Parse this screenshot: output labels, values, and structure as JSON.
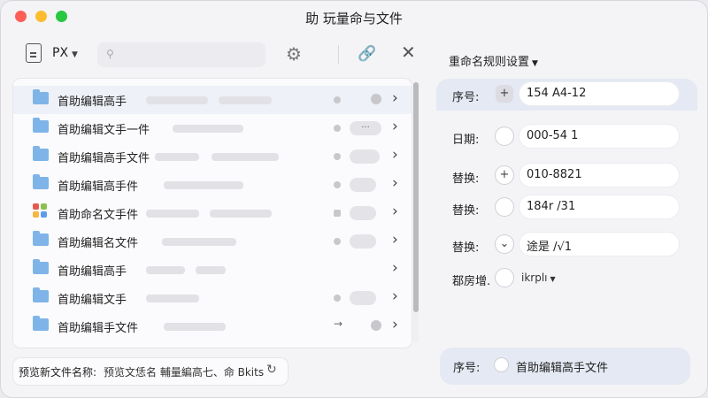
{
  "window": {
    "title": "助 玩量命与文件"
  },
  "toolbar": {
    "format_label": "PX",
    "icons": [
      "file-icon",
      "search-icon",
      "gear-icon",
      "link-icon",
      "close-icon"
    ]
  },
  "file_list": {
    "rows": [
      {
        "name": "首助编辑高手",
        "icon": "folder-icon",
        "badge": ""
      },
      {
        "name": "首助编辑文手一件",
        "icon": "folder-icon",
        "badge": "···"
      },
      {
        "name": "首助编辑高手文件",
        "icon": "folder-icon",
        "badge": ""
      },
      {
        "name": "首助编辑高手件",
        "icon": "folder-icon",
        "badge": ""
      },
      {
        "name": "首助命名文手件",
        "icon": "app-icon",
        "badge": ""
      },
      {
        "name": "首助编辑名文件",
        "icon": "folder-icon",
        "badge": ""
      },
      {
        "name": "首助编辑高手",
        "icon": "folder-icon",
        "badge": ""
      },
      {
        "name": "首助编辑文手",
        "icon": "folder-icon",
        "badge": ""
      },
      {
        "name": "首助编辑手文件",
        "icon": "folder-icon",
        "badge": ""
      }
    ]
  },
  "preview": {
    "label": "预览新文件名称:",
    "value": "预览文恁名 輔量編高七、命 Bkits"
  },
  "rules": {
    "header": "重命名规则设置",
    "items": [
      {
        "label": "序号:",
        "control": "+",
        "value": "154 A4-12"
      },
      {
        "label": "日期:",
        "control": "",
        "value": "000-54 1"
      },
      {
        "label": "替换:",
        "control": "+",
        "value": "010-8821"
      },
      {
        "label": "替换:",
        "control": "",
        "value": "184r /31"
      },
      {
        "label": "替换:",
        "control": "⌄",
        "value": "途是 /√1"
      }
    ],
    "extra": {
      "label": "鄀房增.",
      "select_value": "ikrplı"
    }
  },
  "result": {
    "label": "序号:",
    "value": "首助编辑高手文件"
  },
  "colors": {
    "folder": "#7fb4e8",
    "accent_bg": "#e4e9f3",
    "close_red": "#fe5f57",
    "minimize_yellow": "#febc2e",
    "zoom_green": "#28c840"
  }
}
